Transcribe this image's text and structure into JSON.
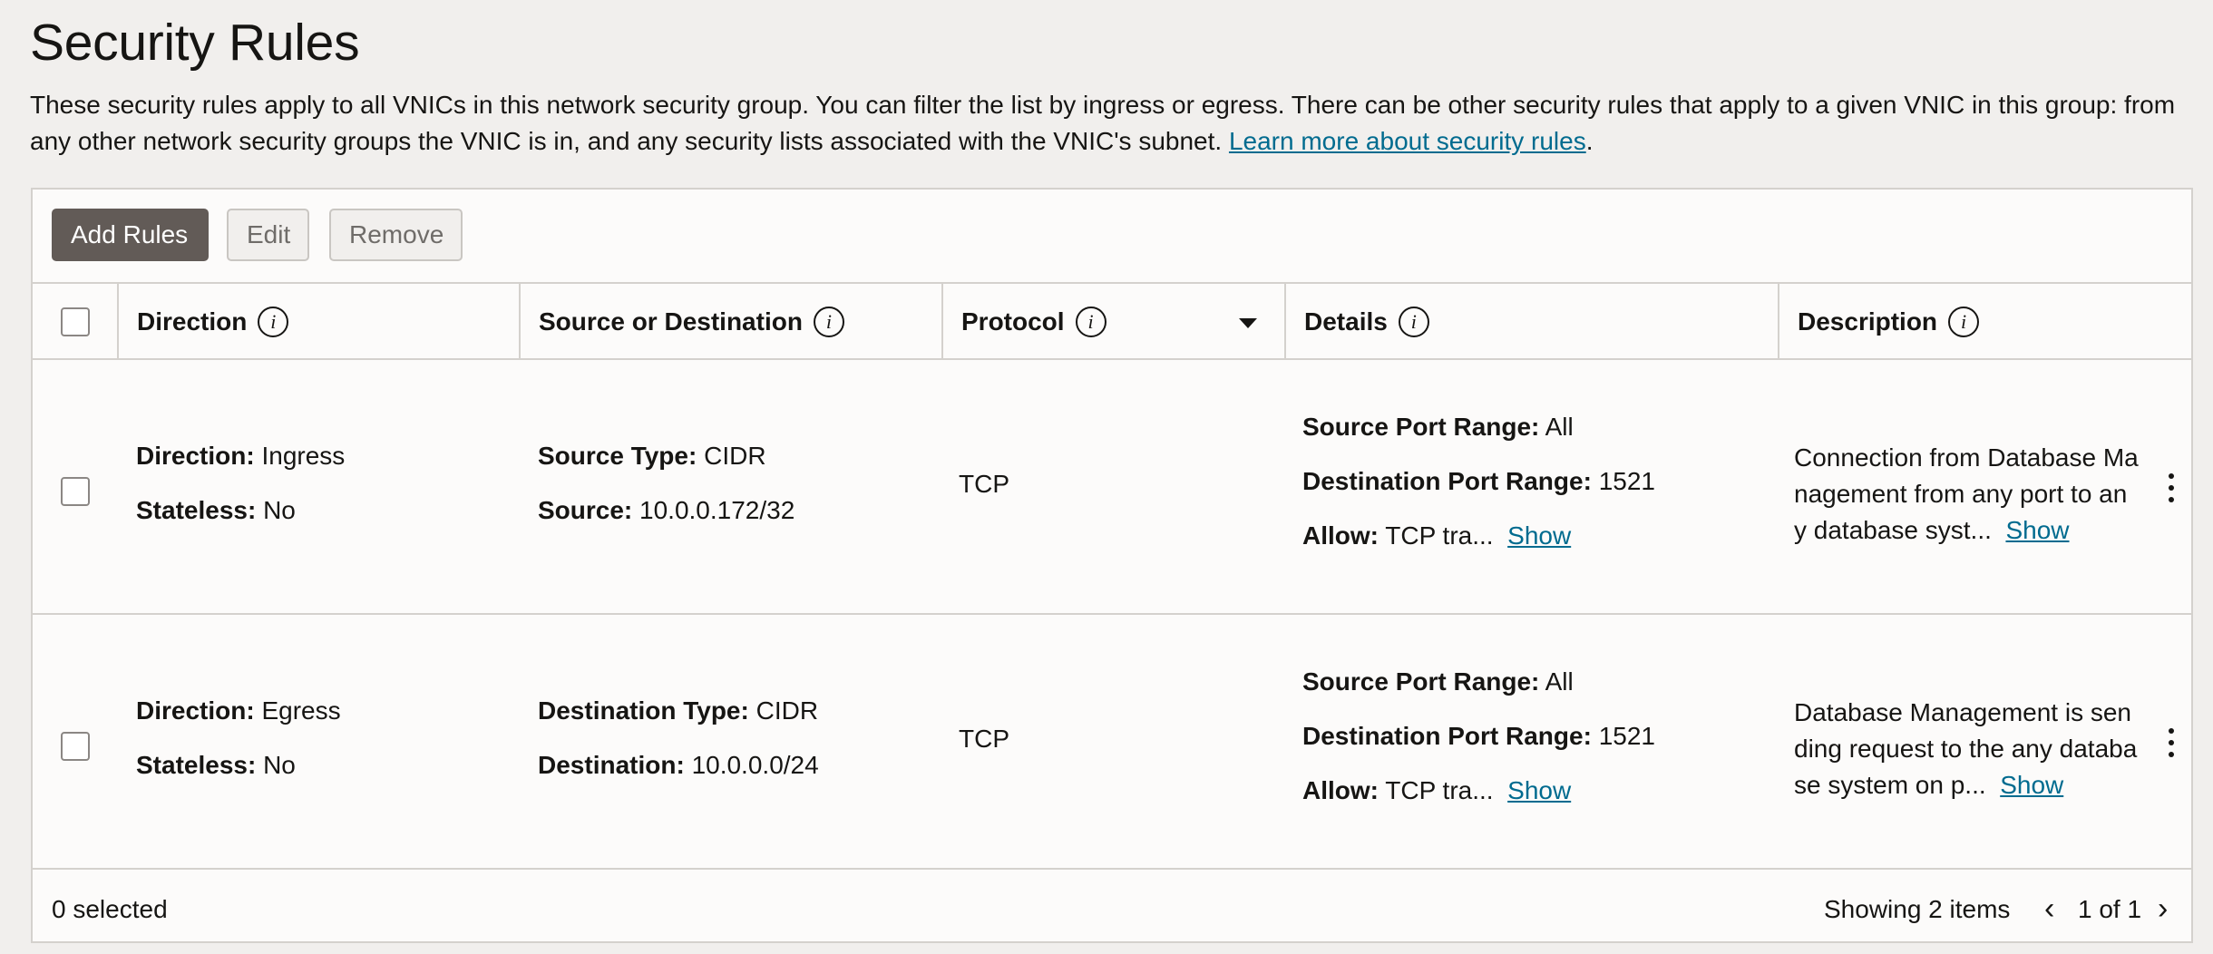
{
  "page": {
    "title": "Security Rules",
    "intro_text": "These security rules apply to all VNICs in this network security group. You can filter the list by ingress or egress. There can be other security rules that apply to a given VNIC in this group: from any other network security groups the VNIC is in, and any security lists associated with the VNIC's subnet. ",
    "intro_link": "Learn more about security rules",
    "intro_suffix": "."
  },
  "toolbar": {
    "add_label": "Add Rules",
    "edit_label": "Edit",
    "remove_label": "Remove"
  },
  "table": {
    "columns": {
      "direction": "Direction",
      "source_dest": "Source or Destination",
      "protocol": "Protocol",
      "details": "Details",
      "description": "Description"
    },
    "rows": [
      {
        "direction_key": "Direction:",
        "direction_val": "Ingress",
        "stateless_key": "Stateless:",
        "stateless_val": "No",
        "type_key": "Source Type:",
        "type_val": "CIDR",
        "addr_key": "Source:",
        "addr_val": "10.0.0.172/32",
        "protocol": "TCP",
        "spr_key": "Source Port Range:",
        "spr_val": "All",
        "dpr_key": "Destination Port Range:",
        "dpr_val": "1521",
        "allow_key": "Allow:",
        "allow_val": "TCP tra...",
        "show_label": "Show",
        "description": "Connection from Database Management from any port to any database syst...",
        "desc_show": "Show"
      },
      {
        "direction_key": "Direction:",
        "direction_val": "Egress",
        "stateless_key": "Stateless:",
        "stateless_val": "No",
        "type_key": "Destination Type:",
        "type_val": "CIDR",
        "addr_key": "Destination:",
        "addr_val": "10.0.0.0/24",
        "protocol": "TCP",
        "spr_key": "Source Port Range:",
        "spr_val": "All",
        "dpr_key": "Destination Port Range:",
        "dpr_val": "1521",
        "allow_key": "Allow:",
        "allow_val": "TCP tra...",
        "show_label": "Show",
        "description": "Database Management is sending request to the any database system on p...",
        "desc_show": "Show"
      }
    ]
  },
  "footer": {
    "selected": "0 selected",
    "showing": "Showing 2 items",
    "pager": "1 of 1"
  },
  "icons": {
    "info": "info-icon",
    "sort": "caret-down-icon",
    "kebab": "more-actions-icon",
    "prev": "chevron-left-icon",
    "next": "chevron-right-icon"
  },
  "colors": {
    "primary_button": "#625b57",
    "link": "#006b8f",
    "background": "#f1efed",
    "panel": "#fcfbfa"
  }
}
